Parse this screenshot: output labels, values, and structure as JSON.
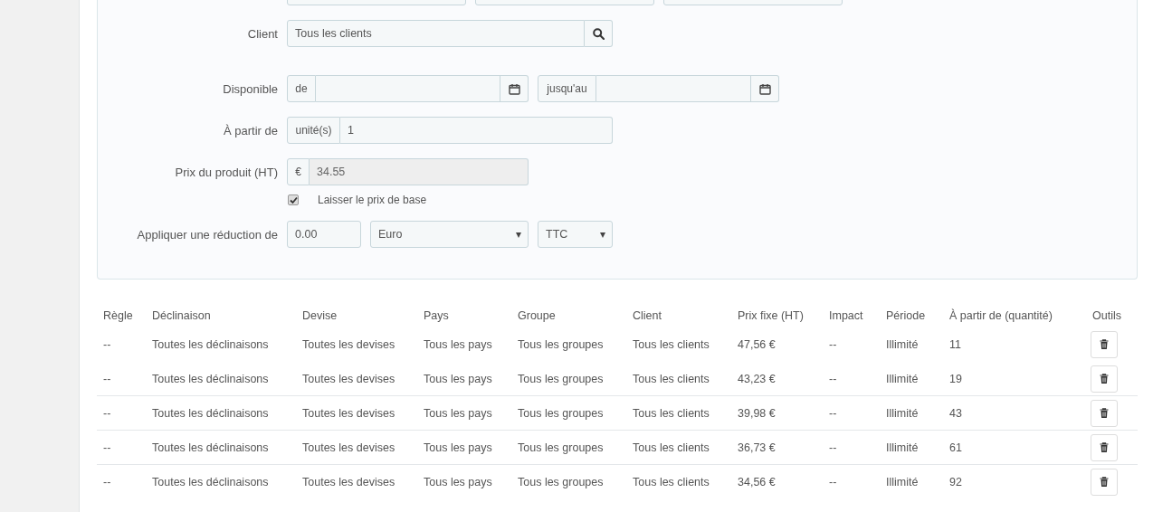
{
  "form": {
    "client": {
      "label": "Client",
      "value": "Tous les clients"
    },
    "available": {
      "label": "Disponible",
      "from_prefix": "de",
      "to_prefix": "jusqu'au"
    },
    "from_quantity": {
      "label": "À partir de",
      "prefix": "unité(s)",
      "value": "1"
    },
    "price": {
      "label": "Prix du produit (HT)",
      "prefix": "€",
      "value": "34.55",
      "disabled": true
    },
    "keep_base_price": {
      "label": "Laisser le prix de base",
      "checked": true
    },
    "reduction": {
      "label": "Appliquer une réduction de",
      "value": "0.00",
      "currency": "Euro",
      "tax": "TTC"
    }
  },
  "table": {
    "columns": [
      "Règle",
      "Déclinaison",
      "Devise",
      "Pays",
      "Groupe",
      "Client",
      "Prix fixe (HT)",
      "Impact",
      "Période",
      "À partir de (quantité)",
      "Outils"
    ],
    "rows": [
      {
        "cells": [
          "--",
          "Toutes les déclinaisons",
          "Toutes les devises",
          "Tous les pays",
          "Tous les groupes",
          "Tous les clients",
          "47,56 €",
          "--",
          "Illimité",
          "11"
        ]
      },
      {
        "cells": [
          "--",
          "Toutes les déclinaisons",
          "Toutes les devises",
          "Tous les pays",
          "Tous les groupes",
          "Tous les clients",
          "43,23 €",
          "--",
          "Illimité",
          "19"
        ]
      },
      {
        "cells": [
          "--",
          "Toutes les déclinaisons",
          "Toutes les devises",
          "Tous les pays",
          "Tous les groupes",
          "Tous les clients",
          "39,98 €",
          "--",
          "Illimité",
          "43"
        ]
      },
      {
        "cells": [
          "--",
          "Toutes les déclinaisons",
          "Toutes les devises",
          "Tous les pays",
          "Tous les groupes",
          "Tous les clients",
          "36,73 €",
          "--",
          "Illimité",
          "61"
        ]
      },
      {
        "cells": [
          "--",
          "Toutes les déclinaisons",
          "Toutes les devises",
          "Tous les pays",
          "Tous les groupes",
          "Tous les clients",
          "34,56 €",
          "--",
          "Illimité",
          "92"
        ]
      }
    ]
  }
}
